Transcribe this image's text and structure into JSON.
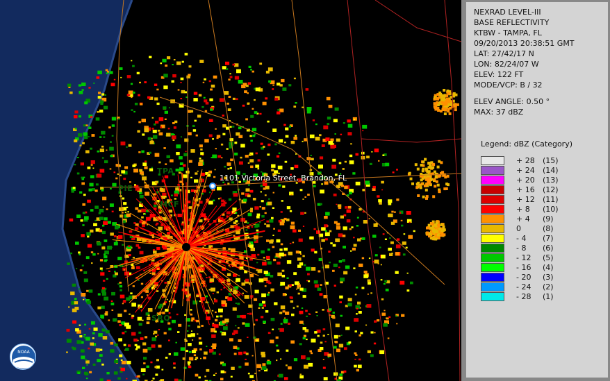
{
  "map": {
    "stations": [
      {
        "id": "tpa",
        "label": "TPA"
      },
      {
        "id": "pie",
        "label": "PIE"
      },
      {
        "id": "mcf",
        "label": "MCF"
      },
      {
        "id": "srq",
        "label": "SRQ"
      }
    ],
    "address_label": "1101 Victoria Street, Brandon, FL",
    "logo_text": "NOAA",
    "colors": {
      "background": "#000000",
      "water": "#122a5e",
      "roads": "#c8781e",
      "boundaries": "#b02222"
    }
  },
  "info": {
    "product": "NEXRAD LEVEL-III",
    "type": "BASE REFLECTIVITY",
    "site": "KTBW - TAMPA, FL",
    "datetime": "09/20/2013 20:38:51 GMT",
    "lat": "LAT: 27/42/17 N",
    "lon": "LON: 82/24/07 W",
    "elev": "ELEV: 122 FT",
    "mode": "MODE/VCP: B / 32",
    "elev_angle": "ELEV ANGLE: 0.50 °",
    "max": "MAX: 37 dBZ"
  },
  "legend": {
    "title": "Legend: dBZ (Category)",
    "items": [
      {
        "value": "+ 28",
        "cat": "(15)",
        "color": "#e8e8e8"
      },
      {
        "value": "+ 24",
        "cat": "(14)",
        "color": "#9a56c8"
      },
      {
        "value": "+ 20",
        "cat": "(13)",
        "color": "#ff00ff"
      },
      {
        "value": "+ 16",
        "cat": "(12)",
        "color": "#c80000"
      },
      {
        "value": "+ 12",
        "cat": "(11)",
        "color": "#dd0000"
      },
      {
        "value": "+ 8",
        "cat": "(10)",
        "color": "#ff0000"
      },
      {
        "value": "+ 4",
        "cat": "(9)",
        "color": "#ff9000"
      },
      {
        "value": "0",
        "cat": "(8)",
        "color": "#e8b800"
      },
      {
        "value": "- 4",
        "cat": "(7)",
        "color": "#ffff00"
      },
      {
        "value": "- 8",
        "cat": "(6)",
        "color": "#008a00"
      },
      {
        "value": "- 12",
        "cat": "(5)",
        "color": "#00c800"
      },
      {
        "value": "- 16",
        "cat": "(4)",
        "color": "#00ff00"
      },
      {
        "value": "- 20",
        "cat": "(3)",
        "color": "#0000ff"
      },
      {
        "value": "- 24",
        "cat": "(2)",
        "color": "#0099ff"
      },
      {
        "value": "- 28",
        "cat": "(1)",
        "color": "#00e8e8"
      }
    ]
  }
}
